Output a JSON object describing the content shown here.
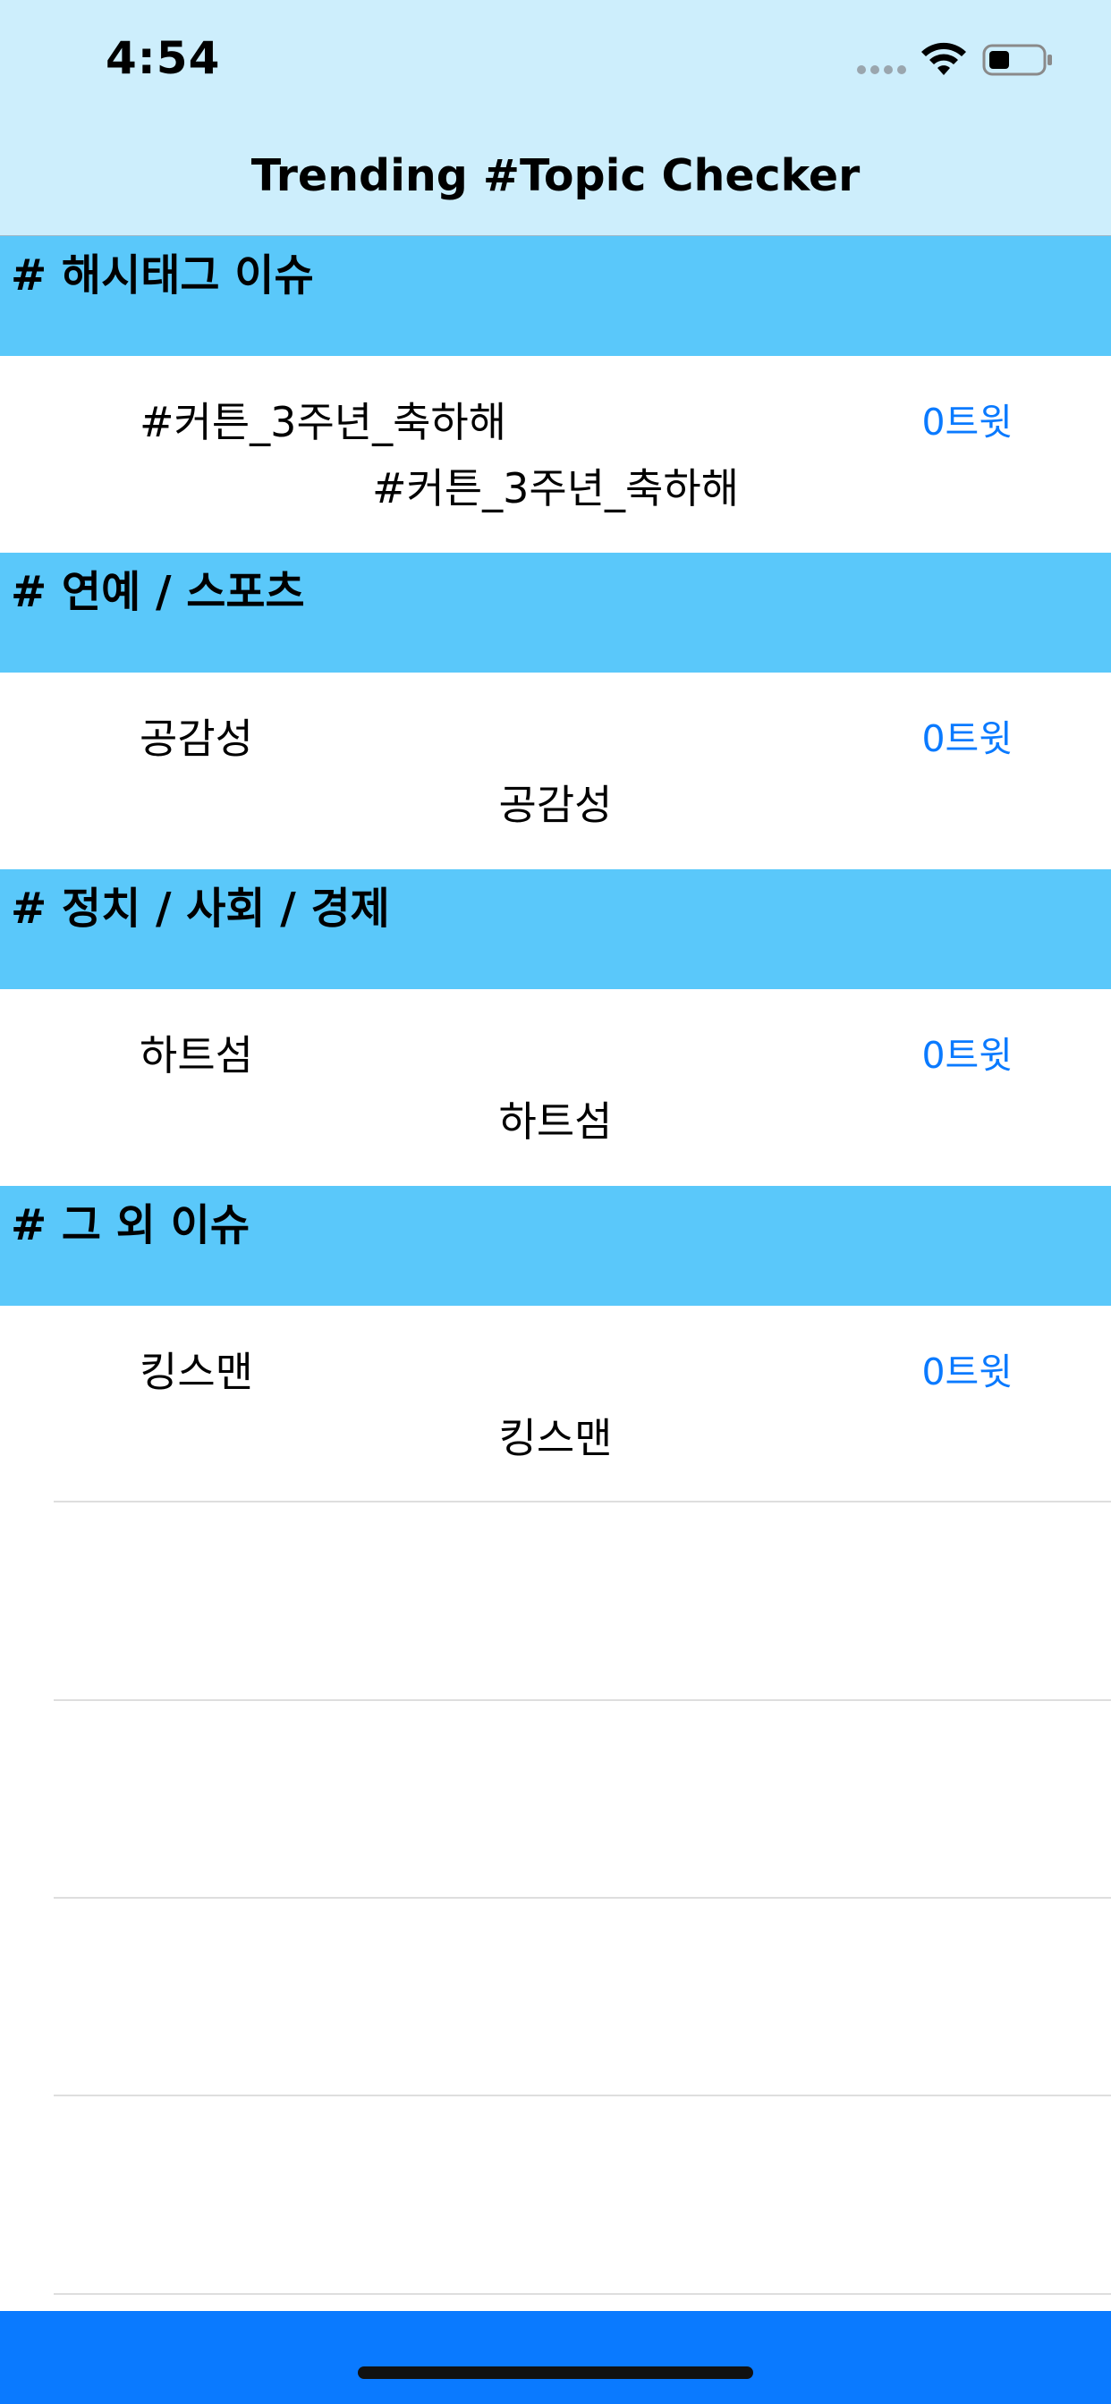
{
  "status_bar": {
    "time": "4:54",
    "icons": [
      "signal-dots-icon",
      "wifi-icon",
      "battery-icon"
    ]
  },
  "nav": {
    "title": "Trending #Topic Checker"
  },
  "sections": [
    {
      "header": "# 해시태그 이슈",
      "row": {
        "title": "#커튼_3주년_축하해",
        "count": "0트윗",
        "subtitle": "#커튼_3주년_축하해"
      }
    },
    {
      "header": "# 연예 / 스포츠",
      "row": {
        "title": "공감성",
        "count": "0트윗",
        "subtitle": "공감성"
      }
    },
    {
      "header": "# 정치 / 사회 / 경제",
      "row": {
        "title": "하트섬",
        "count": "0트윗",
        "subtitle": "하트섬"
      }
    },
    {
      "header": "# 그 외 이슈",
      "row": {
        "title": "킹스맨",
        "count": "0트윗",
        "subtitle": "킹스맨"
      }
    }
  ],
  "colors": {
    "nav_background": "#cdeefc",
    "section_header": "#5ac8fa",
    "accent": "#0a7aff",
    "bottom_bar": "#0a7aff"
  }
}
